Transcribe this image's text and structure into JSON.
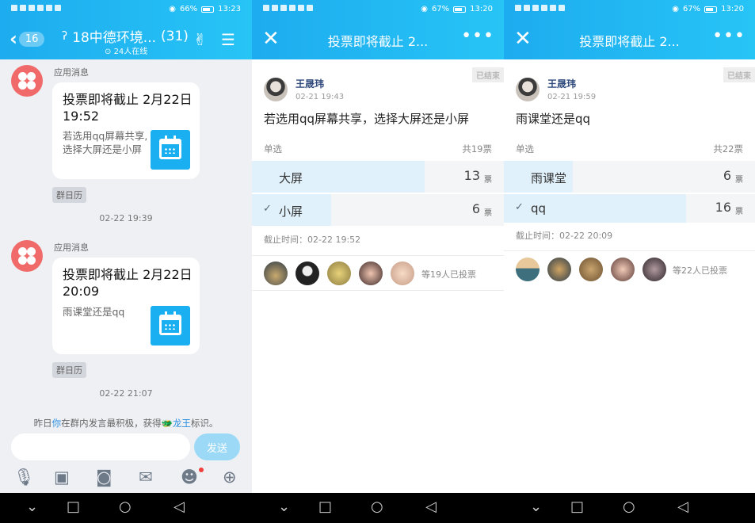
{
  "panel1": {
    "status": {
      "battery": "66%",
      "time": "13:23"
    },
    "header": {
      "back_count": "16",
      "title": "18中德环境...",
      "member_count": "(31)",
      "online": "24人在线"
    },
    "messages": [
      {
        "sender": "应用消息",
        "title": "投票即将截止 2月22日19:52",
        "desc": "若选用qq屏幕共享,选择大屏还是小屏",
        "tag": "群日历"
      },
      {
        "sender": "应用消息",
        "title": "投票即将截止 2月22日20:09",
        "desc": "雨课堂还是qq",
        "tag": "群日历"
      }
    ],
    "timestamps": [
      "02-22 19:39",
      "02-22 21:07"
    ],
    "system_message": {
      "part1": "昨日",
      "part2": "你",
      "part3": "在群内发言最积极，获得",
      "part4": "龙王",
      "part5": "标识。"
    },
    "input": {
      "placeholder": "",
      "send_label": "发送"
    },
    "toolbar_icons": [
      "microphone-icon",
      "image-icon",
      "camera-icon",
      "red-packet-icon",
      "emoji-icon",
      "plus-icon"
    ]
  },
  "panel2": {
    "status": {
      "battery": "67%",
      "time": "13:20"
    },
    "title": "投票即将截止 2...",
    "ended_label": "已结束",
    "author": {
      "name": "王晟玮",
      "time": "02-21 19:43"
    },
    "question": "若选用qq屏幕共享，选择大屏还是小屏",
    "type_label": "单选",
    "total_label": "共19票",
    "options": [
      {
        "label": "大屏",
        "count": "13",
        "unit": "票",
        "fraction": 0.684,
        "checked": false
      },
      {
        "label": "小屏",
        "count": "6",
        "unit": "票",
        "fraction": 0.316,
        "checked": true
      }
    ],
    "deadline": "截止时间：02-22 19:52",
    "voters_text": "等19人已投票"
  },
  "panel3": {
    "status": {
      "battery": "67%",
      "time": "13:20"
    },
    "title": "投票即将截止 2...",
    "ended_label": "已结束",
    "author": {
      "name": "王晟玮",
      "time": "02-21 19:59"
    },
    "question": "雨课堂还是qq",
    "type_label": "单选",
    "total_label": "共22票",
    "options": [
      {
        "label": "雨课堂",
        "count": "6",
        "unit": "票",
        "fraction": 0.273,
        "checked": false
      },
      {
        "label": "qq",
        "count": "16",
        "unit": "票",
        "fraction": 0.727,
        "checked": true
      }
    ],
    "deadline": "截止时间：02-22 20:09",
    "voters_text": "等22人已投票"
  },
  "colors": {
    "accent": "#1dacef",
    "bar_fill": "#e1f1fb",
    "avatar_red": "#f06a6a"
  }
}
